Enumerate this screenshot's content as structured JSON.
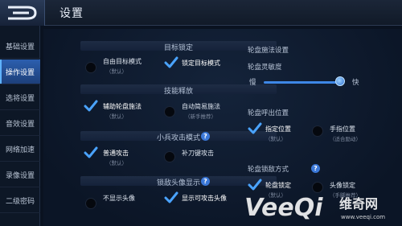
{
  "header": {
    "title": "设置"
  },
  "sidebar": {
    "items": [
      {
        "label": "基础设置",
        "active": false
      },
      {
        "label": "操作设置",
        "active": true
      },
      {
        "label": "选将设置",
        "active": false
      },
      {
        "label": "音效设置",
        "active": false
      },
      {
        "label": "网络加速",
        "active": false
      },
      {
        "label": "录像设置",
        "active": false
      },
      {
        "label": "二级密码",
        "active": false
      }
    ]
  },
  "left": {
    "target_lock": {
      "title": "目标锁定",
      "options": [
        {
          "label": "自由目标模式",
          "sub": "（默认）",
          "selected": false
        },
        {
          "label": "锁定目标模式",
          "sub": "",
          "selected": true
        }
      ]
    },
    "skill_cast": {
      "title": "技能释放",
      "options": [
        {
          "label": "辅助轮盘施法",
          "sub": "（默认）",
          "selected": true
        },
        {
          "label": "自动简易施法",
          "sub": "（新手推荐）",
          "selected": false
        }
      ]
    },
    "minion_attack": {
      "title": "小兵攻击模式",
      "help": "?",
      "options": [
        {
          "label": "普通攻击",
          "sub": "（默认）",
          "selected": true
        },
        {
          "label": "补刀键攻击",
          "sub": "",
          "selected": false
        }
      ]
    },
    "enemy_avatar": {
      "title": "锁敌头像显示",
      "help": "?",
      "options": [
        {
          "label": "不显示头像",
          "sub": "",
          "selected": false
        },
        {
          "label": "显示可攻击头像",
          "sub": "",
          "selected": true
        }
      ]
    }
  },
  "right": {
    "wheel_cast": {
      "title": "轮盘施法设置",
      "sensitivity_label": "轮盘灵敏度",
      "slow": "慢",
      "fast": "快",
      "sensitivity_value": 0.95
    },
    "wheel_position": {
      "title": "轮盘呼出位置",
      "options": [
        {
          "label": "指定位置",
          "sub": "（默认）",
          "selected": true
        },
        {
          "label": "手指位置",
          "sub": "（适合励动）",
          "selected": false
        }
      ]
    },
    "wheel_lock": {
      "title": "轮盘锁敌方式",
      "help": "?",
      "options": [
        {
          "label": "轮盘锁定",
          "sub": "（默认）",
          "selected": true
        },
        {
          "label": "头像锁定",
          "sub": "（手脚推荐）",
          "selected": false
        }
      ]
    }
  },
  "watermark": {
    "text": "VeeQi",
    "sub": "维奇网",
    "url": "www.veeqi.com"
  }
}
